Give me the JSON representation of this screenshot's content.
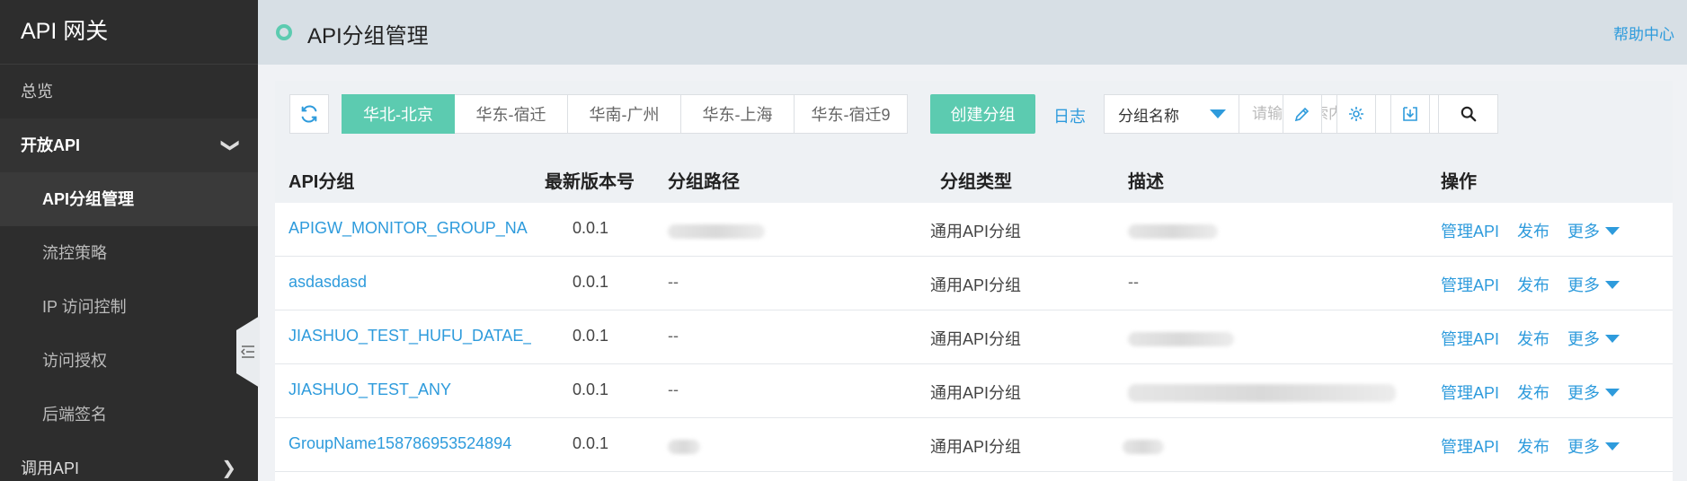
{
  "sidebar": {
    "brand": "API 网关",
    "overview": "总览",
    "open_api": "开放API",
    "items": [
      "API分组管理",
      "流控策略",
      "IP 访问控制",
      "访问授权",
      "后端签名"
    ],
    "call_api": "调用API"
  },
  "header": {
    "title": "API分组管理",
    "help": "帮助中心"
  },
  "toolbar": {
    "regions": [
      "华北-北京",
      "华东-宿迁",
      "华南-广州",
      "华东-上海",
      "华东-宿迁9"
    ],
    "create_label": "创建分组",
    "log_label": "日志",
    "select_value": "分组名称",
    "search_placeholder": "请输入搜索内容"
  },
  "table": {
    "headers": {
      "group": "API分组",
      "version": "最新版本号",
      "path": "分组路径",
      "type": "分组类型",
      "desc": "描述",
      "ops": "操作"
    },
    "rows": [
      {
        "name": "APIGW_MONITOR_GROUP_NA",
        "version": "0.0.1",
        "path": "",
        "type": "通用API分组",
        "desc": ""
      },
      {
        "name": "asdasdasd",
        "version": "0.0.1",
        "path": "--",
        "type": "通用API分组",
        "desc": "--"
      },
      {
        "name": "JIASHUO_TEST_HUFU_DATAE_&",
        "version": "0.0.1",
        "path": "--",
        "type": "通用API分组",
        "desc": ""
      },
      {
        "name": "JIASHUO_TEST_ANY",
        "version": "0.0.1",
        "path": "--",
        "type": "通用API分组",
        "desc": ""
      },
      {
        "name": "GroupName158786953524894",
        "version": "0.0.1",
        "path": "",
        "type": "通用API分组",
        "desc": ""
      }
    ],
    "op_labels": {
      "manage": "管理API",
      "publish": "发布",
      "more": "更多"
    }
  },
  "colors": {
    "accent": "#5ccbb0",
    "link": "#2e9bdc",
    "sidebar": "#2d2d2d"
  }
}
